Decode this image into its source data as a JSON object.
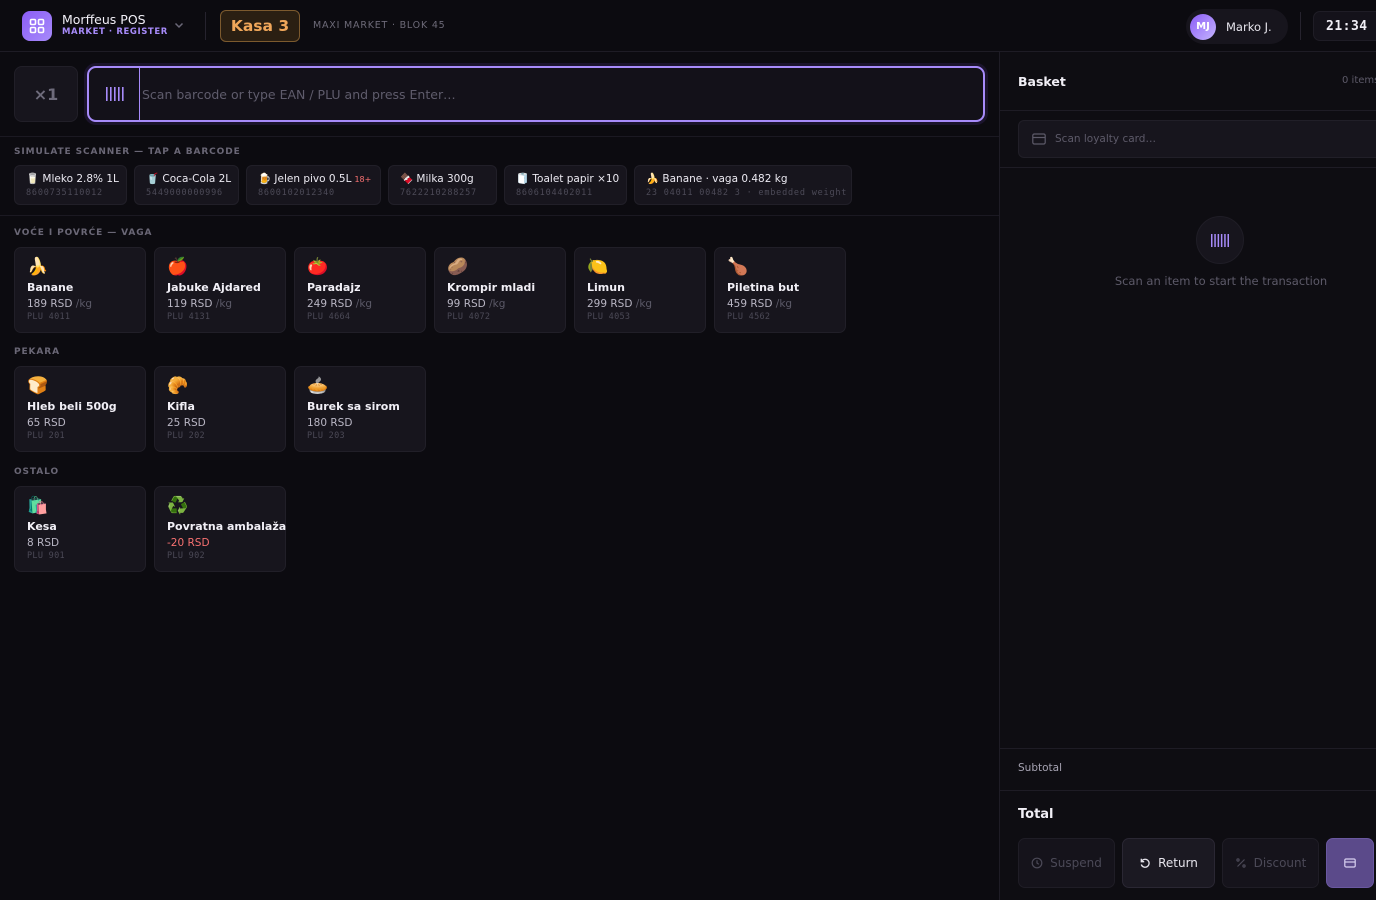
{
  "header": {
    "app_name": "Morffeus POS",
    "app_subtitle": "MARKET · REGISTER",
    "register_label": "Kasa 3",
    "store_name": "MAXI MARKET · BLOK 45",
    "user_initials": "MJ",
    "user_name": "Marko J.",
    "clock": "21:34"
  },
  "scanner": {
    "quantity": "×1",
    "placeholder": "Scan barcode or type EAN / PLU and press Enter…",
    "value": ""
  },
  "simulate": {
    "label": "SIMULATE SCANNER — TAP A BARCODE",
    "chips": [
      {
        "icon": "🥛",
        "name": "Mleko 2.8% 1L",
        "code": "8600735110012",
        "age": ""
      },
      {
        "icon": "🥤",
        "name": "Coca-Cola 2L",
        "code": "5449000000996",
        "age": ""
      },
      {
        "icon": "🍺",
        "name": "Jelen pivo 0.5L",
        "code": "8600102012340",
        "age": "18+"
      },
      {
        "icon": "🍫",
        "name": "Milka 300g",
        "code": "7622210288257",
        "age": ""
      },
      {
        "icon": "🧻",
        "name": "Toalet papir ×10",
        "code": "8606104402011",
        "age": ""
      },
      {
        "icon": "🍌",
        "name": "Banane · vaga 0.482 kg",
        "code": "23 04011 00482 3 · embedded weight",
        "age": ""
      }
    ]
  },
  "categories": [
    {
      "label": "VOĆE I POVRĆE — VAGA",
      "items": [
        {
          "icon": "🍌",
          "name": "Banane",
          "price": "189 RSD",
          "unit": "/kg",
          "plu": "PLU 4011"
        },
        {
          "icon": "🍎",
          "name": "Jabuke Ajdared",
          "price": "119 RSD",
          "unit": "/kg",
          "plu": "PLU 4131"
        },
        {
          "icon": "🍅",
          "name": "Paradajz",
          "price": "249 RSD",
          "unit": "/kg",
          "plu": "PLU 4664"
        },
        {
          "icon": "🥔",
          "name": "Krompir mladi",
          "price": "99 RSD",
          "unit": "/kg",
          "plu": "PLU 4072"
        },
        {
          "icon": "🍋",
          "name": "Limun",
          "price": "299 RSD",
          "unit": "/kg",
          "plu": "PLU 4053"
        },
        {
          "icon": "🍗",
          "name": "Piletina but",
          "price": "459 RSD",
          "unit": "/kg",
          "plu": "PLU 4562"
        }
      ]
    },
    {
      "label": "PEKARA",
      "items": [
        {
          "icon": "🍞",
          "name": "Hleb beli 500g",
          "price": "65 RSD",
          "unit": "",
          "plu": "PLU 201"
        },
        {
          "icon": "🥐",
          "name": "Kifla",
          "price": "25 RSD",
          "unit": "",
          "plu": "PLU 202"
        },
        {
          "icon": "🥧",
          "name": "Burek sa sirom",
          "price": "180 RSD",
          "unit": "",
          "plu": "PLU 203"
        }
      ]
    },
    {
      "label": "OSTALO",
      "items": [
        {
          "icon": "🛍️",
          "name": "Kesa",
          "price": "8 RSD",
          "unit": "",
          "plu": "PLU 901"
        },
        {
          "icon": "♻️",
          "name": "Povratna ambalaža",
          "price": "-20 RSD",
          "unit": "",
          "plu": "PLU 902"
        }
      ]
    }
  ],
  "basket": {
    "title": "Basket",
    "count": "0 items",
    "loyalty_placeholder": "Scan loyalty card…",
    "empty_text": "Scan an item to start the transaction",
    "subtotal_label": "Subtotal",
    "total_label": "Total",
    "actions": {
      "suspend": "Suspend",
      "return": "Return",
      "discount": "Discount"
    }
  },
  "colors": {
    "accent": "#8b5cf6",
    "register": "#f0a75a",
    "negative": "#f87171"
  }
}
